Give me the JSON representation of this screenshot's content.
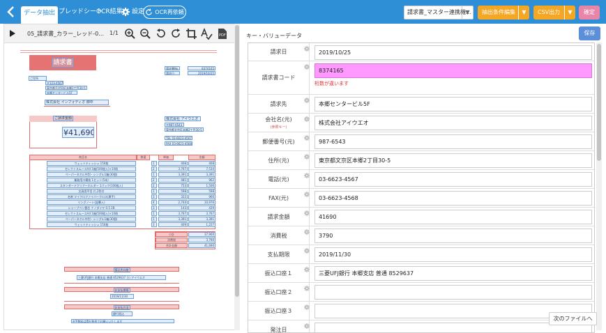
{
  "header": {
    "tabs": [
      "データ抽出",
      "スプレッドシート",
      "OCR結果",
      "設定"
    ],
    "ocr_retry": "OCR再依頼",
    "template_select": "請求書_マスター連携機…",
    "extract_settings": "抽出条件編集",
    "csv_export": "CSV出力",
    "confirm": "確定"
  },
  "viewer": {
    "filename": "05_請求書_カラー_レッド-0…",
    "page_indicator": "1/1"
  },
  "invoice": {
    "title": "請求書",
    "info_labels": [
      "請求書No",
      "請求日"
    ],
    "info_values": [
      "8374165",
      "2019/10/25"
    ],
    "address_lines": [
      "〒123-4567",
      "東京都千代田区本郷1丁目30-5",
      "本郷センタービル5F"
    ],
    "address_label": "ご住所",
    "customer": "株式会社 インフォディオ 御中",
    "amount_label": "ご請求金額",
    "amount": "¥41,690",
    "issuer": "株式会社 アイウエオ",
    "issuer_lines": [
      "〒987-6543",
      "東京都文京区本郷2丁目30-5",
      "TEL 03-6623-4567",
      "FAX 03-6623-4568"
    ],
    "table_headers": [
      "商品名",
      "数量",
      "単価",
      "金額"
    ],
    "items": [
      [
        "ウェットティッシュ 150枚",
        "1",
        "408",
        "408"
      ],
      [
        "セレクトスムースA4 1箱(500枚入)×10冊",
        "2",
        "3,767",
        "7,534"
      ],
      [
        "ペーパータオル中判・シングル1箱(30個)",
        "1",
        "3,391",
        "3,391"
      ],
      [
        "業務用爪楊枝 1セット(5本)",
        "2",
        "481",
        "962"
      ],
      [
        "スタンダードクリアーホルダー 1パック(100枚入)",
        "2",
        "753",
        "1,506"
      ],
      [
        "文具用平目 片,2色付",
        "1",
        "598",
        "598"
      ],
      [
        "名刺 マイクロファイバークロス(厚手)",
        "3",
        "322",
        "966"
      ],
      [
        "リングノート(鉛筆入)",
        "4",
        "2,744",
        "10,976"
      ],
      [
        "シャープペン替芯 ナノダイヤ 0.5 2B",
        "3",
        "143",
        "429"
      ],
      [
        "セレクトスムースA4 1箱(500枚入)×10冊",
        "1",
        "3,767",
        "3,767"
      ],
      [
        "ペーパータオル中判・シングル1箱(30個)",
        "1",
        "3,391",
        "3,391"
      ],
      [
        "ウェットティッシュ 150枚",
        "3",
        "409",
        "1,227"
      ]
    ],
    "summary_labels": [
      "小計",
      "消費税",
      "合計金額"
    ],
    "summary_values": [
      "37,900",
      "3,790",
      "41,690"
    ],
    "bank_label": "振込先口座",
    "bank_value": "三菱UFJ銀行 本郷支店 普通 8529637 カ) アイウエオ",
    "deadline_label": "お支払期限",
    "deadline_value": "2019/11/30",
    "method_label": "お支払方法",
    "method_value": "銀行振込",
    "note": "※手数料は貴社負担でお願いいたします"
  },
  "kv": {
    "title": "キー・バリューデータ",
    "save": "保存",
    "rows": [
      {
        "label": "請求日",
        "value": "2019/10/25"
      },
      {
        "label": "請求書コード",
        "value": "8374165",
        "error": "桁数が違います"
      },
      {
        "label": "請求先",
        "value": "本郷センタービル5F"
      },
      {
        "label": "会社名(元)",
        "sub": "(参照キー)",
        "value": "株式会社アイウエオ"
      },
      {
        "label": "郵便番号(元)",
        "value": "987-6543"
      },
      {
        "label": "住所(元)",
        "value": "東京都文京区本郷2丁目30-5"
      },
      {
        "label": "電話(元)",
        "value": "03-6623-4567"
      },
      {
        "label": "FAX(元)",
        "value": "03-6623-4568"
      },
      {
        "label": "請求金額",
        "value": "41690"
      },
      {
        "label": "消費税",
        "value": "3790"
      },
      {
        "label": "支払期限",
        "value": "2019/11/30"
      },
      {
        "label": "振込口座１",
        "value": "三菱UFJ銀行 本郷支店 普通 8529637"
      },
      {
        "label": "振込口座２",
        "value": ""
      },
      {
        "label": "振込口座３",
        "value": ""
      },
      {
        "label": "発注日",
        "value": ""
      }
    ],
    "next_file": "次のファイルへ"
  }
}
